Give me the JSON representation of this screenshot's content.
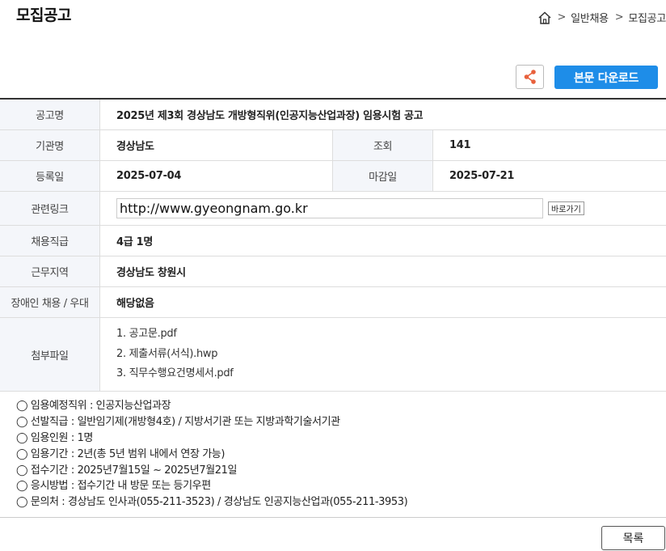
{
  "page": {
    "title": "모집공고"
  },
  "breadcrumb": {
    "home_icon": "home-icon",
    "items": [
      "일반채용",
      "모집공고"
    ],
    "separator": ">"
  },
  "toolbar": {
    "share_icon": "share-icon",
    "download_label": "본문 다운로드"
  },
  "info": {
    "title_label": "공고명",
    "title_value": "2025년 제3회 경상남도 개방형직위(인공지능산업과장) 임용시험 공고",
    "agency_label": "기관명",
    "agency_value": "경상남도",
    "views_label": "조회",
    "views_value": "141",
    "reg_label": "등록일",
    "reg_value": "2025-07-04",
    "deadline_label": "마감일",
    "deadline_value": "2025-07-21",
    "link_label": "관련링크",
    "link_value": "http://www.gyeongnam.go.kr",
    "go_label": "바로가기",
    "position_label": "채용직급",
    "position_value": "4급 1명",
    "region_label": "근무지역",
    "region_value": "경상남도 창원시",
    "disabled_label": "장애인 채용 / 우대",
    "disabled_value": "해당없음",
    "files_label": "첨부파일",
    "files": [
      "1. 공고문.pdf",
      "2. 제출서류(서식).hwp",
      "3. 직무수행요건명세서.pdf"
    ]
  },
  "notice": [
    "◯ 임용예정직위 : 인공지능산업과장",
    "◯ 선발직급 : 일반임기제(개방형4호) / 지방서기관 또는 지방과학기술서기관",
    "◯ 임용인원 : 1명",
    "◯ 임용기간 : 2년(총 5년 범위 내에서 연장 가능)",
    "◯ 접수기간 : 2025년7월15일 ~ 2025년7월21일",
    "◯ 응시방법 : 접수기간 내 방문 또는 등기우편",
    "◯ 문의처 : 경상남도 인사과(055-211-3523) / 경상남도 인공지능산업과(055-211-3953)"
  ],
  "footer": {
    "list_label": "목록"
  },
  "colors": {
    "accent": "#1e8de8",
    "share": "#e8603c",
    "header_bg": "#f4f6fa"
  }
}
